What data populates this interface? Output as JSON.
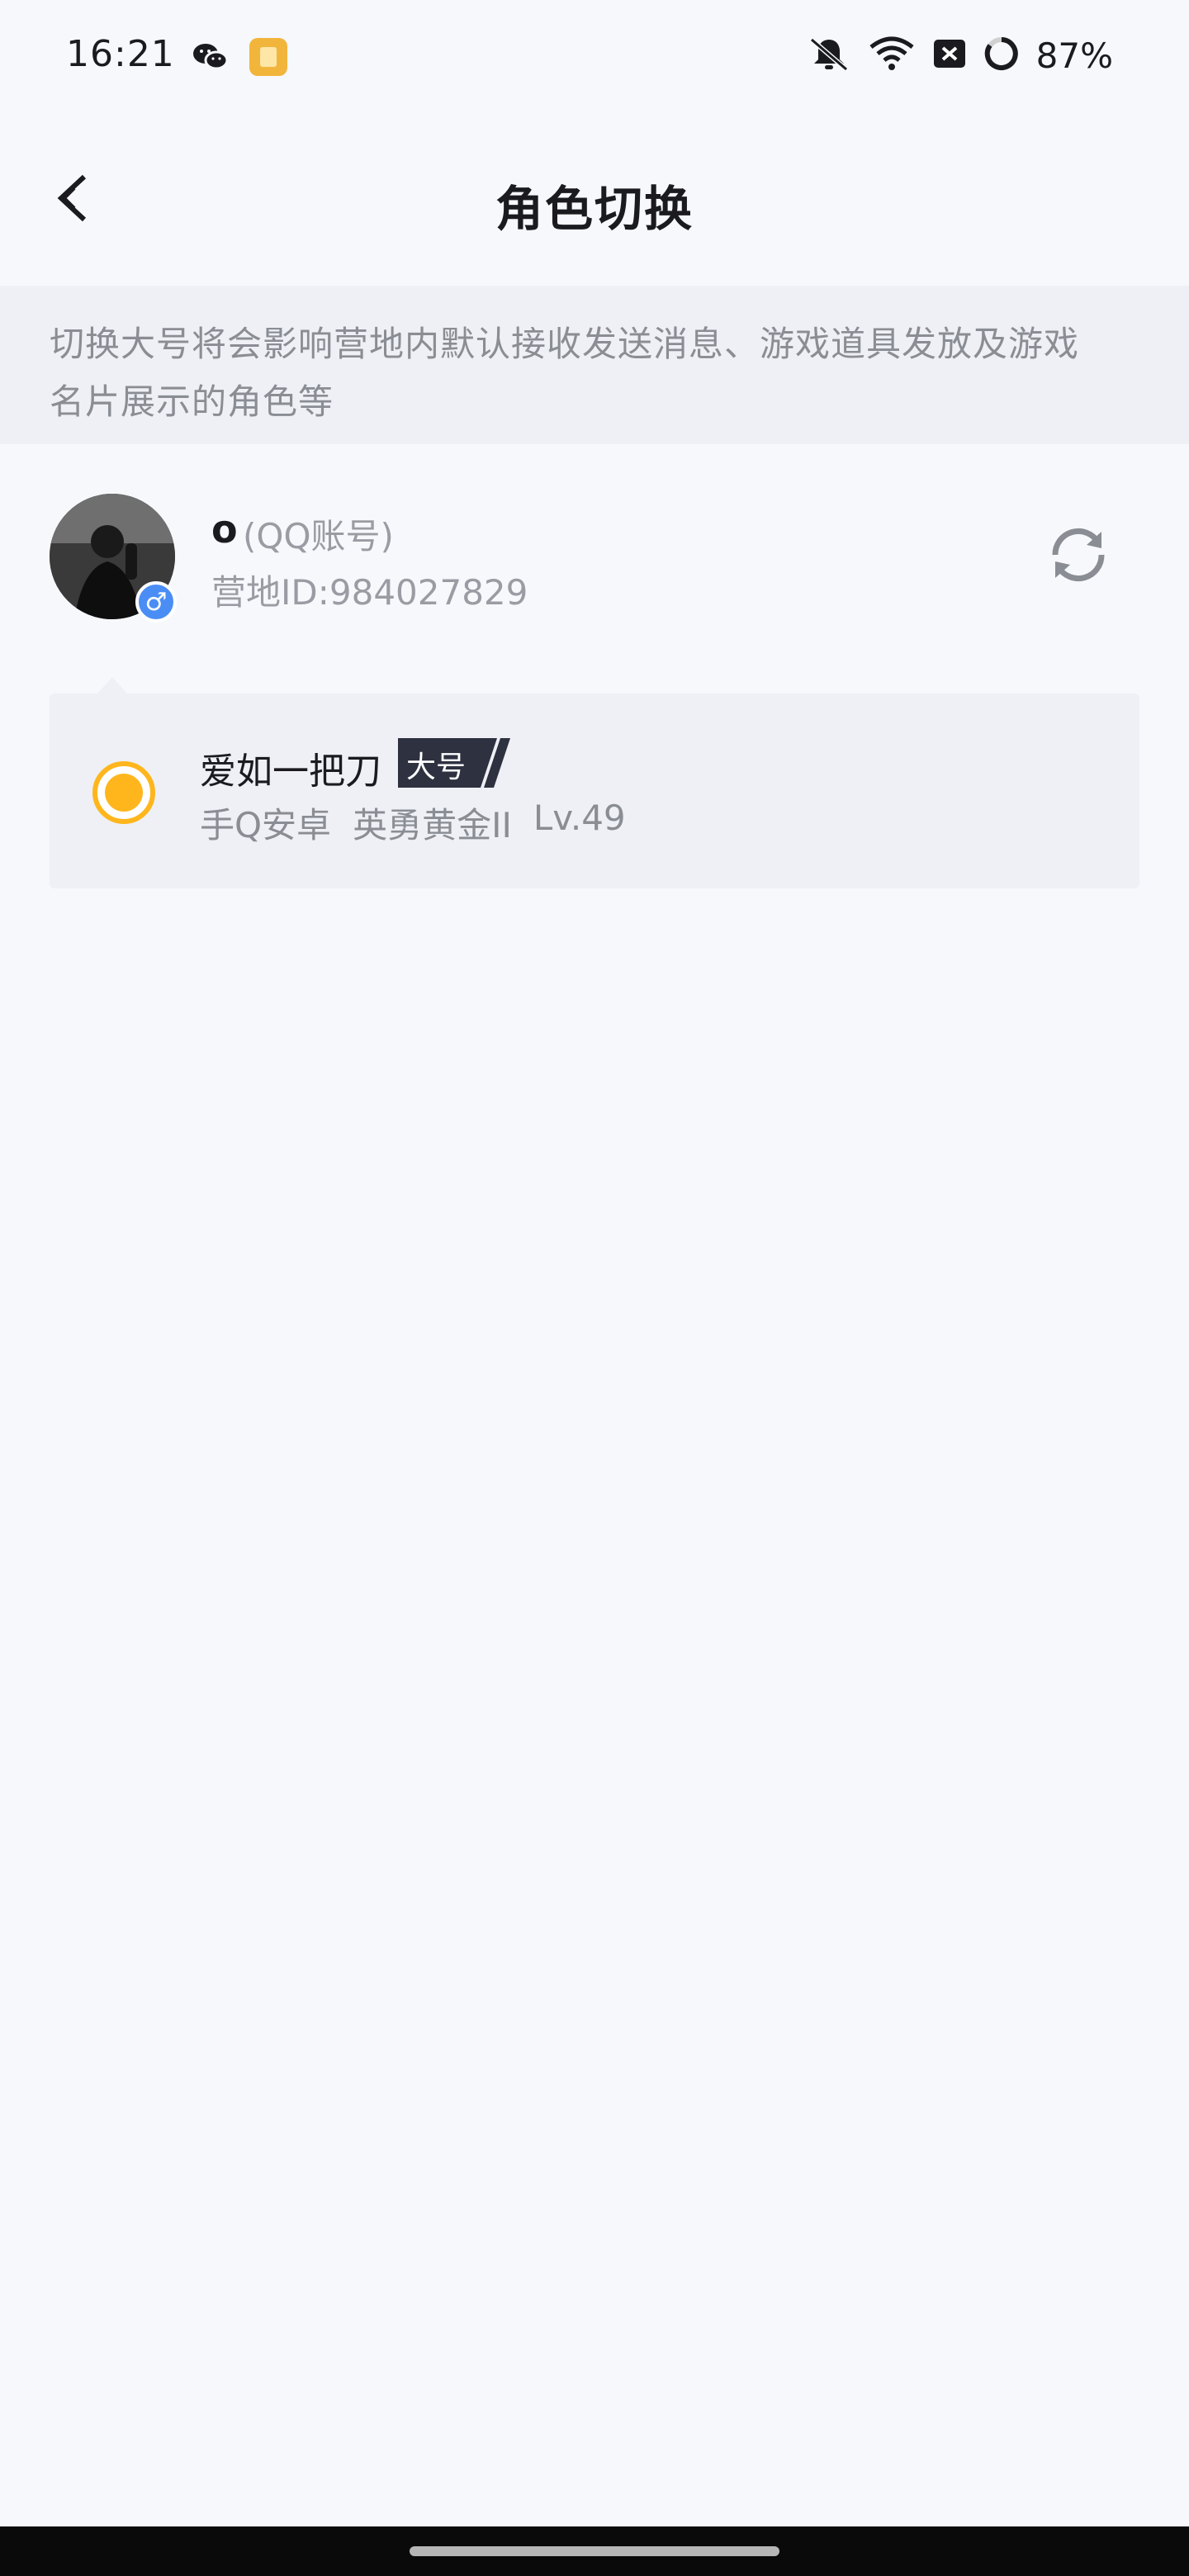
{
  "status_bar": {
    "time": "16:21",
    "battery_percent": "87%",
    "icons": [
      "wechat-icon",
      "book-app-icon",
      "mute-icon",
      "wifi-icon",
      "sim-off-icon",
      "battery-ring-icon"
    ]
  },
  "header": {
    "title": "角色切换",
    "back_icon": "chevron-left-icon"
  },
  "notice": {
    "text_line1": "切换大号将会影响营地内默认接收发送消息、游戏道具发放及游戏",
    "text_line2": "名片展示的角色等"
  },
  "account": {
    "name": "o",
    "type_label": "(QQ账号)",
    "camp_id": "营地ID:984027829",
    "gender_icon": "male-icon",
    "refresh_icon": "refresh-icon"
  },
  "roles": [
    {
      "name": "爱如一把刀",
      "tag": "大号",
      "platform": "手Q安卓",
      "rank": "英勇黄金II",
      "level": "Lv.49",
      "selected": true
    }
  ],
  "colors": {
    "accent": "#ffb61d",
    "background": "#f6f8fc",
    "card": "#eef0f5",
    "tag_bg": "#2d3140",
    "gender_badge": "#4a8ef5"
  }
}
